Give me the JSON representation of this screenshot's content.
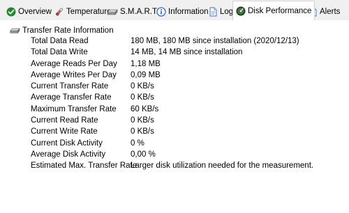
{
  "tabs": [
    {
      "label": "Overview",
      "icon": "green-check-icon",
      "active": false
    },
    {
      "label": "Temperature",
      "icon": "thermometer-icon",
      "active": false
    },
    {
      "label": "S.M.A.R.T.",
      "icon": "disk-drive-icon",
      "active": false
    },
    {
      "label": "Information",
      "icon": "info-icon",
      "active": false
    },
    {
      "label": "Log",
      "icon": "document-icon",
      "active": false
    },
    {
      "label": "Disk Performance",
      "icon": "gauge-icon",
      "active": true
    },
    {
      "label": "Alerts",
      "icon": "alert-document-icon",
      "active": false
    }
  ],
  "section": {
    "title": "Transfer Rate Information",
    "icon": "disk-drive-icon"
  },
  "rows": [
    {
      "label": "Total Data Read",
      "value": "180 MB,  180 MB since installation  (2020/12/13)"
    },
    {
      "label": "Total Data Write",
      "value": "14 MB,  14 MB since installation"
    },
    {
      "label": "Average Reads Per Day",
      "value": "1,18 MB"
    },
    {
      "label": "Average Writes Per Day",
      "value": "0,09 MB"
    },
    {
      "label": "Current Transfer Rate",
      "value": "0 KB/s"
    },
    {
      "label": "Average Transfer Rate",
      "value": "0 KB/s"
    },
    {
      "label": "Maximum Transfer Rate",
      "value": "60 KB/s"
    },
    {
      "label": "Current Read Rate",
      "value": "0 KB/s"
    },
    {
      "label": "Current Write Rate",
      "value": "0 KB/s"
    },
    {
      "label": "Current Disk Activity",
      "value": "0 %"
    },
    {
      "label": "Average Disk Activity",
      "value": "0,00 %"
    },
    {
      "label": "Estimated Max. Transfer Rate",
      "value": "Larger disk utilization needed for the measurement."
    }
  ],
  "colors": {
    "tab_bar_background": "#f0f0f0",
    "border": "#d4d4d4",
    "check_green": "#1e8c2e",
    "info_blue": "#2f6fd0"
  }
}
